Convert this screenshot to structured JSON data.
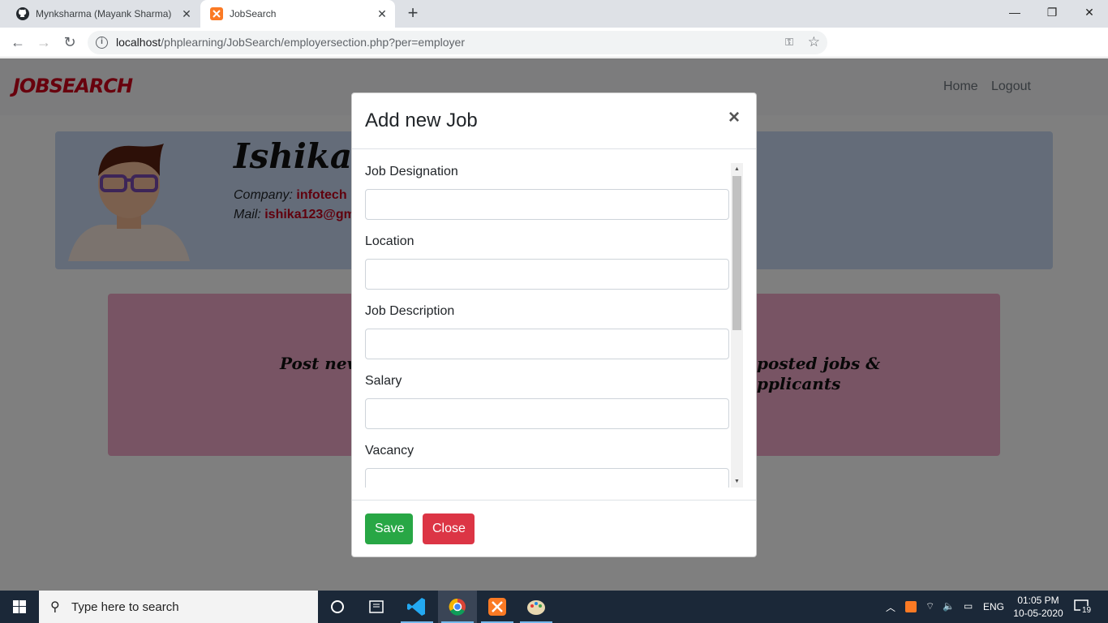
{
  "browser": {
    "tabs": [
      {
        "title": "Mynksharma (Mayank Sharma)",
        "icon": "github-icon",
        "active": false
      },
      {
        "title": "JobSearch",
        "icon": "xampp-icon",
        "active": true
      }
    ],
    "url_host": "localhost",
    "url_path": "/phplearning/JobSearch/employersection.php?per=employer"
  },
  "site": {
    "brand": "JOBSEARCH",
    "nav": {
      "home": "Home",
      "logout": "Logout"
    },
    "profile": {
      "name": "Ishika",
      "company_label": "Company:",
      "company_value": "infotech",
      "mail_label": "Mail:",
      "mail_value": "ishika123@gm"
    },
    "jobs_card": {
      "left_text": "Post new j",
      "right_text_1": "posted jobs &",
      "right_text_2": "pplicants"
    }
  },
  "modal": {
    "title": "Add new Job",
    "close_symbol": "×",
    "fields": [
      {
        "label": "Job Designation",
        "value": ""
      },
      {
        "label": "Location",
        "value": ""
      },
      {
        "label": "Job Description",
        "value": ""
      },
      {
        "label": "Salary",
        "value": ""
      },
      {
        "label": "Vacancy",
        "value": ""
      }
    ],
    "buttons": {
      "save": "Save",
      "close": "Close"
    }
  },
  "taskbar": {
    "search_placeholder": "Type here to search",
    "language": "ENG",
    "time": "01:05 PM",
    "date": "10-05-2020",
    "notifications": "19"
  },
  "colors": {
    "brand": "#d0021b",
    "save": "#28a745",
    "close": "#dc3545"
  }
}
